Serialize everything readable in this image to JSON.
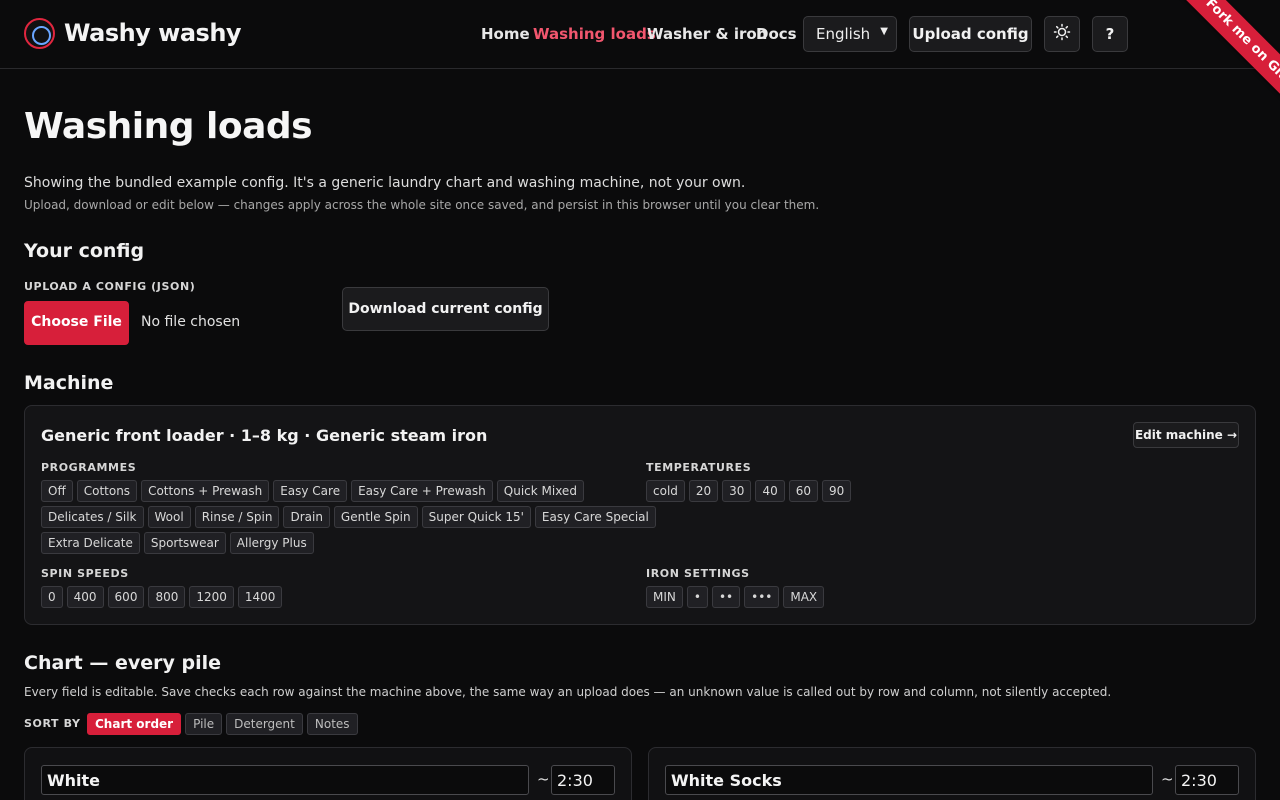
{
  "brand": {
    "name": "Washy washy",
    "logo_icon": "washing-drum-icon"
  },
  "nav": {
    "items": [
      {
        "label": "Home",
        "active": false
      },
      {
        "label": "Washing loads",
        "active": true
      },
      {
        "label": "Washer & iron",
        "active": false
      },
      {
        "label": "Docs",
        "active": false
      }
    ],
    "language": "English",
    "upload_config": "Upload config",
    "theme_icon": "sun-icon",
    "help_label": "?"
  },
  "ribbon": "Fork me on GitHub",
  "page": {
    "title": "Washing loads",
    "intro": "Showing the bundled example config. It's a generic laundry chart and washing machine, not your own.",
    "intro_sub": "Upload, download or edit below — changes apply across the whole site once saved, and persist in this browser until you clear them."
  },
  "config": {
    "heading": "Your config",
    "upload_label": "UPLOAD A CONFIG (JSON)",
    "choose_file": "Choose File",
    "no_file": "No file chosen",
    "download": "Download current config"
  },
  "machine": {
    "heading": "Machine",
    "title": "Generic front loader · 1–8 kg · Generic steam iron",
    "edit_button": "Edit machine →",
    "programmes_label": "PROGRAMMES",
    "programmes": [
      "Off",
      "Cottons",
      "Cottons + Prewash",
      "Easy Care",
      "Easy Care + Prewash",
      "Quick Mixed",
      "Delicates / Silk",
      "Wool",
      "Rinse / Spin",
      "Drain",
      "Gentle Spin",
      "Super Quick 15'",
      "Easy Care Special",
      "Extra Delicate",
      "Sportswear",
      "Allergy Plus"
    ],
    "temperatures_label": "TEMPERATURES",
    "temperatures": [
      "cold",
      "20",
      "30",
      "40",
      "60",
      "90"
    ],
    "spin_label": "SPIN SPEEDS",
    "spin_speeds": [
      "0",
      "400",
      "600",
      "800",
      "1200",
      "1400"
    ],
    "iron_label": "IRON SETTINGS",
    "iron_settings": [
      "MIN",
      "•",
      "••",
      "•••",
      "MAX"
    ]
  },
  "chart": {
    "heading": "Chart — every pile",
    "description": "Every field is editable. Save checks each row against the machine above, the same way an upload does — an unknown value is called out by row and column, not silently accepted.",
    "sort_label": "SORT BY",
    "sort_options": [
      {
        "label": "Chart order",
        "active": true
      },
      {
        "label": "Pile",
        "active": false
      },
      {
        "label": "Detergent",
        "active": false
      },
      {
        "label": "Notes",
        "active": false
      }
    ],
    "piles": [
      {
        "name": "White",
        "time": "2:30"
      },
      {
        "name": "White Socks",
        "time": "2:30"
      }
    ],
    "tilde": "~"
  }
}
